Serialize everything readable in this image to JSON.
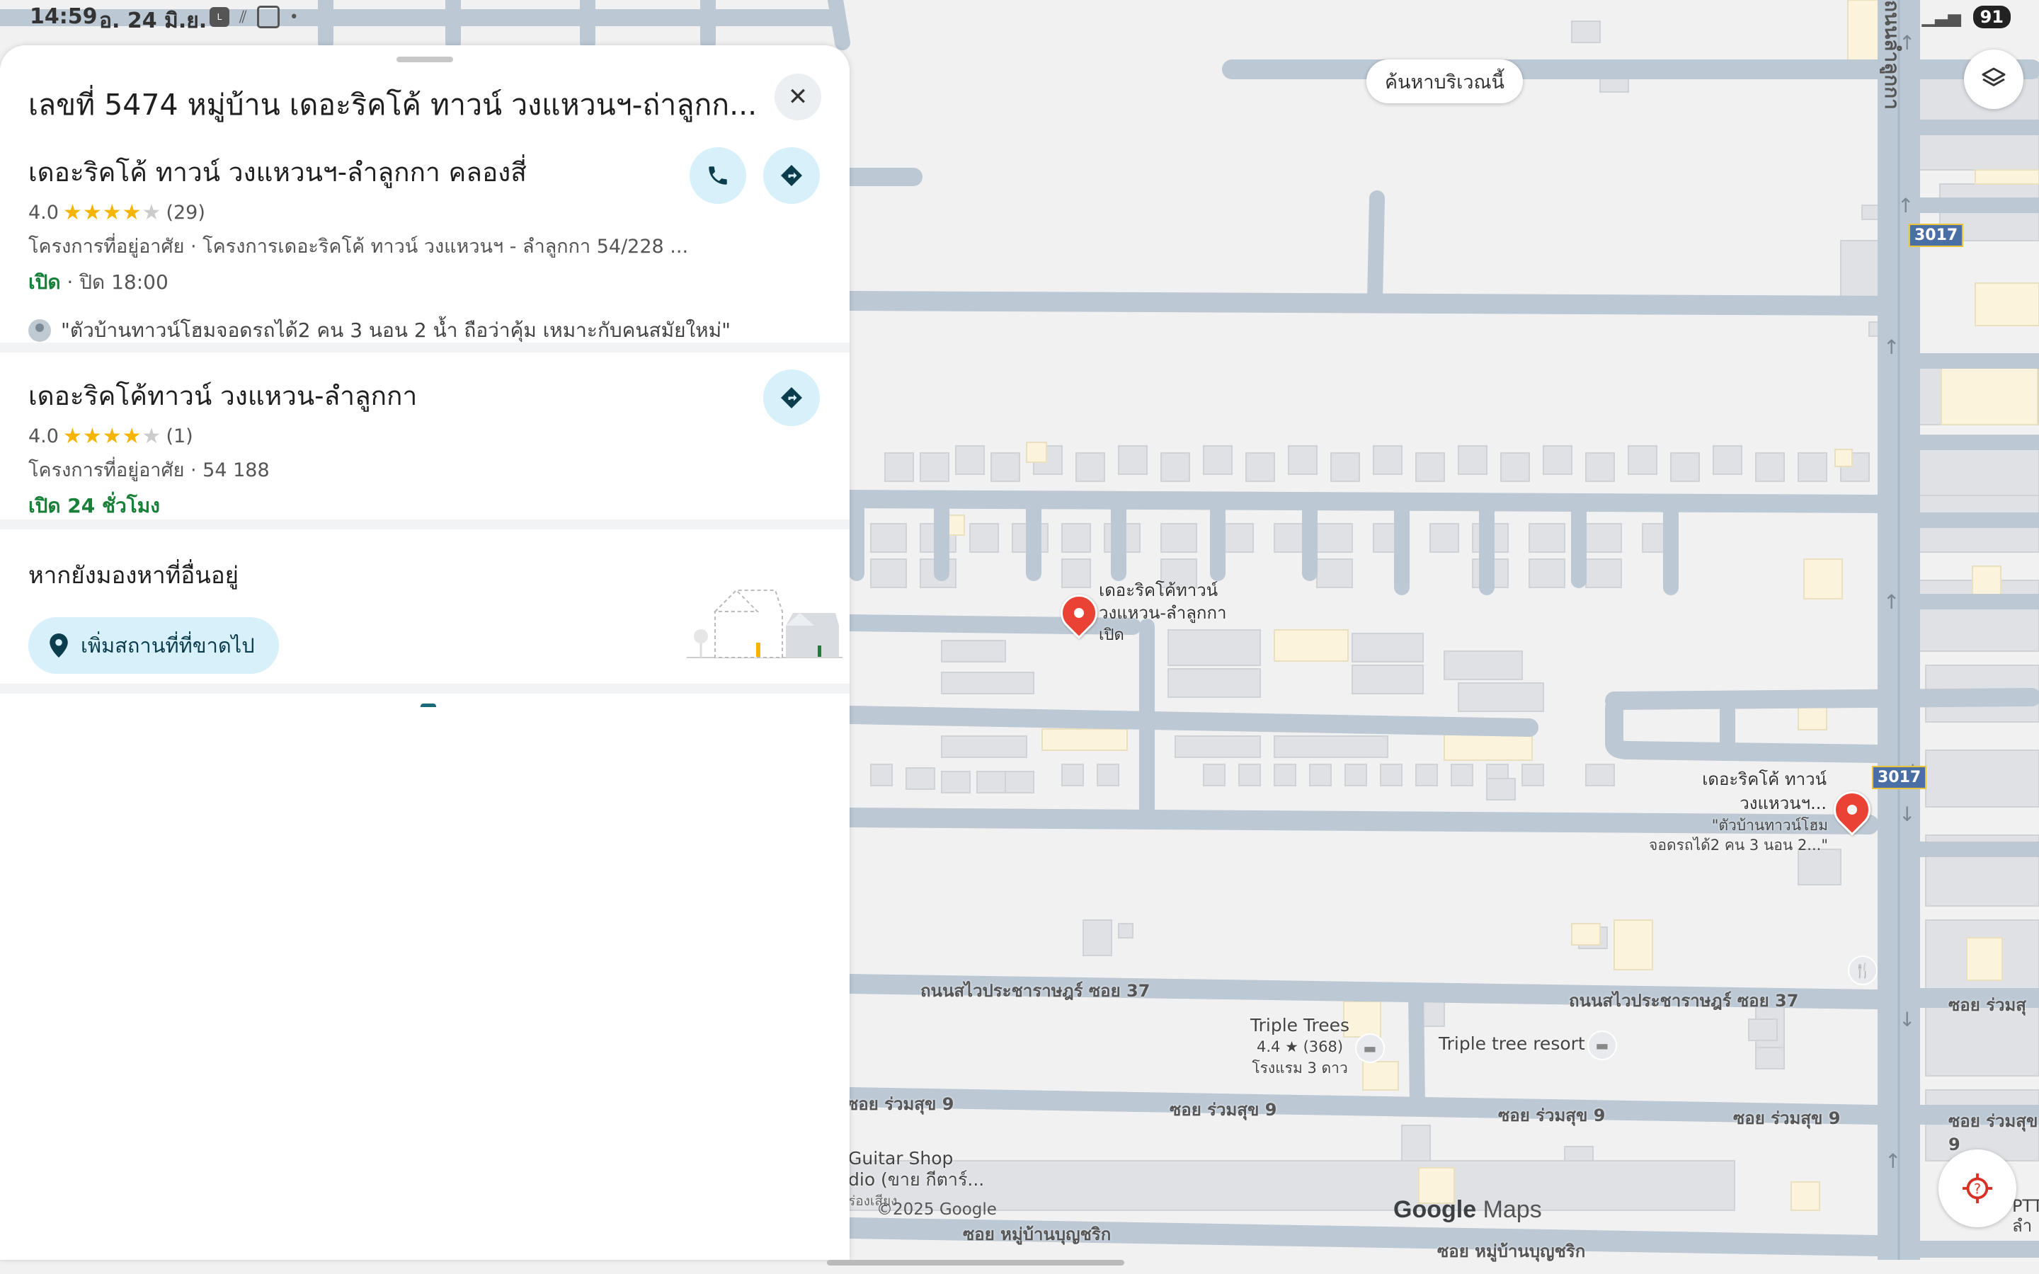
{
  "status_bar": {
    "time": "14:59",
    "date": "อ. 24 มิ.ย.",
    "battery": "91"
  },
  "panel": {
    "title": "เลขที่ 5474 หมู่บ้าน เดอะริคโค้ ทาวน์ วงแหวนฯ-ถ่าลูกก...",
    "results": [
      {
        "name": "เดอะริคโค้ ทาวน์ วงแหวนฯ-ลำลูกกา คลองสี่",
        "rating": "4.0",
        "rating_value": 4.0,
        "reviews": "(29)",
        "category": "โครงการที่อยู่อาศัย · โครงการเดอะริคโค้ ทาวน์ วงแหวนฯ - ลำลูกกา 54/228 ...",
        "open": "เปิด",
        "hours": " · ปิด 18:00",
        "review": "\"ตัวบ้านทาวน์โฮมจอดรถได้2 คน 3 นอน 2 น้ำ ถือว่าคุ้ม เหมาะกับคนสมัยใหม่\""
      },
      {
        "name": "เดอะริคโค้ทาวน์ วงแหวน-ลำลูกกา",
        "rating": "4.0",
        "rating_value": 4.0,
        "reviews": "(1)",
        "category": "โครงการที่อยู่อาศัย · 54 188",
        "open": "เปิด 24 ชั่วโมง"
      }
    ],
    "looking_for": "หากยังมองหาที่อื่นอยู่",
    "add_place": "เพิ่มสถานที่ที่ขาดไป"
  },
  "map": {
    "search_here": "ค้นหาบริเวณนี้",
    "route_badges": [
      "3017",
      "3017"
    ],
    "pins": [
      {
        "label1": "เดอะริคโค้ทาวน์",
        "label2": "วงแหวน-ลำลูกกา",
        "label3": "เปิด"
      },
      {
        "label1": "เดอะริคโค้ ทาวน์",
        "label2": "วงแหวนฯ...",
        "label3": "\"ตัวบ้านทาวน์โฮม",
        "label4": "จอดรถได้2 คน 3 นอน 2...\""
      }
    ],
    "road_labels": {
      "soi37": "ถนนสไวประชาราษฎร์ ซอย 37",
      "soi9": "ซอย ร่วมสุข 9",
      "soi_mu": "ซอย หมู่บ้านบุญชริก",
      "soi_bottom": "ซอย หมู่บ้านบุญชริก",
      "soi_right": "ซอย ร่วมสุ",
      "soi9_right": "ซอย ร่วมสุข 9",
      "vertical_road": "ถนนลำลูกกา"
    },
    "pois": {
      "triple_trees": "Triple Trees",
      "triple_trees_rating": "4.4 ★ (368)",
      "triple_trees_type": "โรงแรม 3 ดาว",
      "triple_tree_resort": "Triple tree resort",
      "guitar_shop_1": "Guitar Shop",
      "guitar_shop_2": "dio (ขาย กีตาร์...",
      "guitar_shop_3": "ร่องเสียง",
      "ptt": "PTT",
      "ptt2": "ลำ"
    },
    "copyright": "©2025 Google",
    "brand_google": "Google",
    "brand_maps": "Maps"
  },
  "colors": {
    "accent_green": "#188038",
    "pin_red": "#ea4335",
    "button_bg": "#d7f0f9",
    "road": "#bcc8d4"
  }
}
